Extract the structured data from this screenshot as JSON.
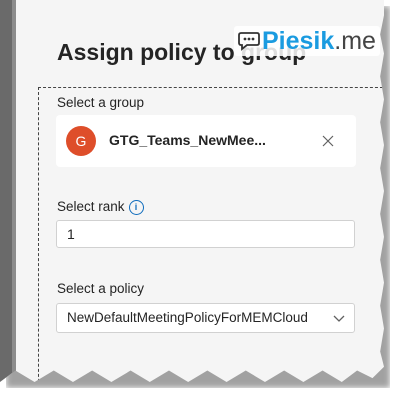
{
  "dialog": {
    "title": "Assign policy to group"
  },
  "group": {
    "label": "Select a group",
    "avatar_letter": "G",
    "avatar_color": "#de4e2a",
    "name": "GTG_Teams_NewMee..."
  },
  "rank": {
    "label": "Select rank",
    "value": "1",
    "info_icon": "info-icon"
  },
  "policy": {
    "label": "Select a policy",
    "selected": "NewDefaultMeetingPolicyForMEMCloud"
  },
  "watermark": {
    "word": "Piesik",
    "tld": ".me"
  },
  "colors": {
    "accent": "#0f6cbd",
    "watermark_blue": "#1a9be0"
  }
}
